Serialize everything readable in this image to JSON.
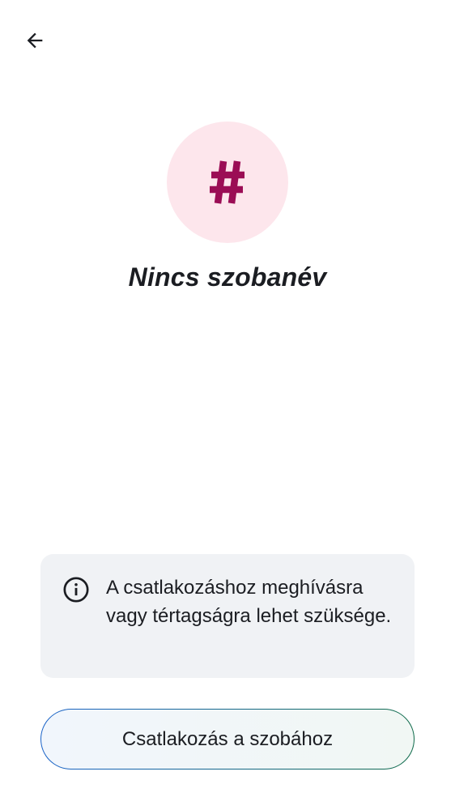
{
  "header": {
    "back_icon": "arrow-left-icon"
  },
  "room": {
    "avatar_glyph": "#",
    "avatar_bg": "#fde6ec",
    "avatar_fg": "#9b0d55",
    "name": "Nincs szobanév"
  },
  "notice": {
    "icon": "info-icon",
    "text": "A csatlakozáshoz meghívásra vagy tértagságra lehet szüksége."
  },
  "actions": {
    "join_label": "Csatlakozás a szobához",
    "border_gradient": [
      "#1a63c9",
      "#0f6b4a"
    ]
  }
}
